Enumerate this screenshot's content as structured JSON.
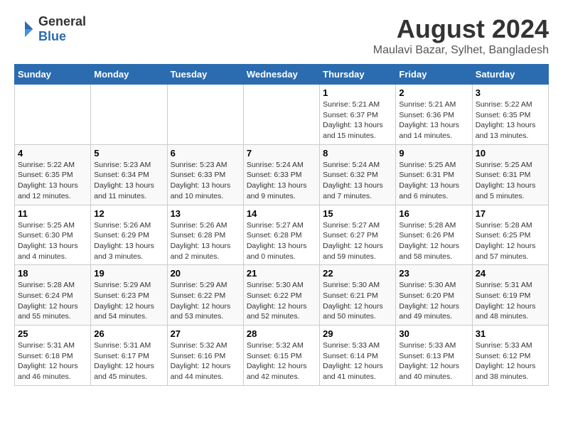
{
  "logo": {
    "general": "General",
    "blue": "Blue"
  },
  "title": "August 2024",
  "subtitle": "Maulavi Bazar, Sylhet, Bangladesh",
  "days_of_week": [
    "Sunday",
    "Monday",
    "Tuesday",
    "Wednesday",
    "Thursday",
    "Friday",
    "Saturday"
  ],
  "weeks": [
    [
      {
        "day": "",
        "info": ""
      },
      {
        "day": "",
        "info": ""
      },
      {
        "day": "",
        "info": ""
      },
      {
        "day": "",
        "info": ""
      },
      {
        "day": "1",
        "info": "Sunrise: 5:21 AM\nSunset: 6:37 PM\nDaylight: 13 hours\nand 15 minutes."
      },
      {
        "day": "2",
        "info": "Sunrise: 5:21 AM\nSunset: 6:36 PM\nDaylight: 13 hours\nand 14 minutes."
      },
      {
        "day": "3",
        "info": "Sunrise: 5:22 AM\nSunset: 6:35 PM\nDaylight: 13 hours\nand 13 minutes."
      }
    ],
    [
      {
        "day": "4",
        "info": "Sunrise: 5:22 AM\nSunset: 6:35 PM\nDaylight: 13 hours\nand 12 minutes."
      },
      {
        "day": "5",
        "info": "Sunrise: 5:23 AM\nSunset: 6:34 PM\nDaylight: 13 hours\nand 11 minutes."
      },
      {
        "day": "6",
        "info": "Sunrise: 5:23 AM\nSunset: 6:33 PM\nDaylight: 13 hours\nand 10 minutes."
      },
      {
        "day": "7",
        "info": "Sunrise: 5:24 AM\nSunset: 6:33 PM\nDaylight: 13 hours\nand 9 minutes."
      },
      {
        "day": "8",
        "info": "Sunrise: 5:24 AM\nSunset: 6:32 PM\nDaylight: 13 hours\nand 7 minutes."
      },
      {
        "day": "9",
        "info": "Sunrise: 5:25 AM\nSunset: 6:31 PM\nDaylight: 13 hours\nand 6 minutes."
      },
      {
        "day": "10",
        "info": "Sunrise: 5:25 AM\nSunset: 6:31 PM\nDaylight: 13 hours\nand 5 minutes."
      }
    ],
    [
      {
        "day": "11",
        "info": "Sunrise: 5:25 AM\nSunset: 6:30 PM\nDaylight: 13 hours\nand 4 minutes."
      },
      {
        "day": "12",
        "info": "Sunrise: 5:26 AM\nSunset: 6:29 PM\nDaylight: 13 hours\nand 3 minutes."
      },
      {
        "day": "13",
        "info": "Sunrise: 5:26 AM\nSunset: 6:28 PM\nDaylight: 13 hours\nand 2 minutes."
      },
      {
        "day": "14",
        "info": "Sunrise: 5:27 AM\nSunset: 6:28 PM\nDaylight: 13 hours\nand 0 minutes."
      },
      {
        "day": "15",
        "info": "Sunrise: 5:27 AM\nSunset: 6:27 PM\nDaylight: 12 hours\nand 59 minutes."
      },
      {
        "day": "16",
        "info": "Sunrise: 5:28 AM\nSunset: 6:26 PM\nDaylight: 12 hours\nand 58 minutes."
      },
      {
        "day": "17",
        "info": "Sunrise: 5:28 AM\nSunset: 6:25 PM\nDaylight: 12 hours\nand 57 minutes."
      }
    ],
    [
      {
        "day": "18",
        "info": "Sunrise: 5:28 AM\nSunset: 6:24 PM\nDaylight: 12 hours\nand 55 minutes."
      },
      {
        "day": "19",
        "info": "Sunrise: 5:29 AM\nSunset: 6:23 PM\nDaylight: 12 hours\nand 54 minutes."
      },
      {
        "day": "20",
        "info": "Sunrise: 5:29 AM\nSunset: 6:22 PM\nDaylight: 12 hours\nand 53 minutes."
      },
      {
        "day": "21",
        "info": "Sunrise: 5:30 AM\nSunset: 6:22 PM\nDaylight: 12 hours\nand 52 minutes."
      },
      {
        "day": "22",
        "info": "Sunrise: 5:30 AM\nSunset: 6:21 PM\nDaylight: 12 hours\nand 50 minutes."
      },
      {
        "day": "23",
        "info": "Sunrise: 5:30 AM\nSunset: 6:20 PM\nDaylight: 12 hours\nand 49 minutes."
      },
      {
        "day": "24",
        "info": "Sunrise: 5:31 AM\nSunset: 6:19 PM\nDaylight: 12 hours\nand 48 minutes."
      }
    ],
    [
      {
        "day": "25",
        "info": "Sunrise: 5:31 AM\nSunset: 6:18 PM\nDaylight: 12 hours\nand 46 minutes."
      },
      {
        "day": "26",
        "info": "Sunrise: 5:31 AM\nSunset: 6:17 PM\nDaylight: 12 hours\nand 45 minutes."
      },
      {
        "day": "27",
        "info": "Sunrise: 5:32 AM\nSunset: 6:16 PM\nDaylight: 12 hours\nand 44 minutes."
      },
      {
        "day": "28",
        "info": "Sunrise: 5:32 AM\nSunset: 6:15 PM\nDaylight: 12 hours\nand 42 minutes."
      },
      {
        "day": "29",
        "info": "Sunrise: 5:33 AM\nSunset: 6:14 PM\nDaylight: 12 hours\nand 41 minutes."
      },
      {
        "day": "30",
        "info": "Sunrise: 5:33 AM\nSunset: 6:13 PM\nDaylight: 12 hours\nand 40 minutes."
      },
      {
        "day": "31",
        "info": "Sunrise: 5:33 AM\nSunset: 6:12 PM\nDaylight: 12 hours\nand 38 minutes."
      }
    ]
  ]
}
